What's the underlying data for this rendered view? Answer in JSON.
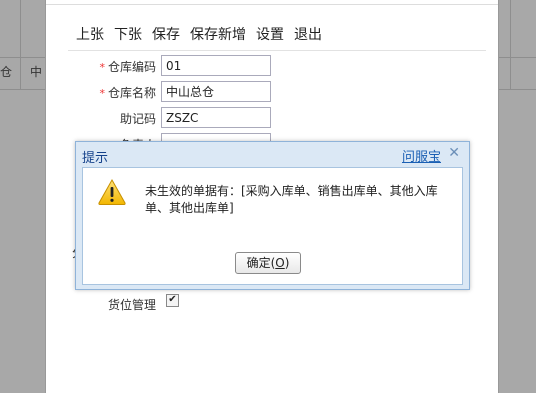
{
  "background": {
    "row_text_1": "仓",
    "row_text_2": "中"
  },
  "toolbar": {
    "prev_label": "上张",
    "next_label": "下张",
    "save_label": "保存",
    "save_new_label": "保存新增",
    "settings_label": "设置",
    "exit_label": "退出"
  },
  "form": {
    "warehouse_code_label": "仓库编码",
    "warehouse_code_value": "01",
    "warehouse_name_label": "仓库名称",
    "warehouse_name_value": "中山总仓",
    "mnemonic_label": "助记码",
    "mnemonic_value": "ZSZC",
    "manager_label": "负责人",
    "location_mgmt_label": "货位管理",
    "location_mgmt_checked": true,
    "partial_left_char": "分"
  },
  "dialog": {
    "title": "提示",
    "help_link": "问服宝",
    "close_glyph": "✕",
    "message": "未生效的单据有：[采购入库单、销售出库单、其他入库单、其他出库单]",
    "ok_label": "确定",
    "ok_hotkey": "O"
  },
  "colors": {
    "dialog_header_bg": "#dbe8f5",
    "dialog_title": "#15428b",
    "required_star": "#e33333"
  },
  "icons": {
    "warning": "warning-triangle-icon",
    "close": "close-icon",
    "checkbox": "checkmark-icon"
  }
}
